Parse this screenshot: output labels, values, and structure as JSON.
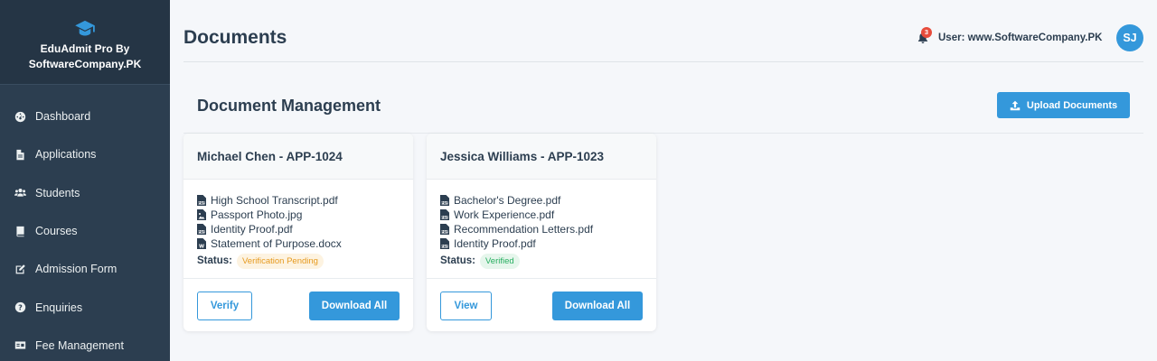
{
  "sidebar": {
    "brand_line1": "EduAdmit Pro By",
    "brand_line2": "SoftwareCompany.PK",
    "brand_icon": "graduation-cap-icon",
    "items": [
      {
        "label": "Dashboard",
        "icon": "dashboard-icon"
      },
      {
        "label": "Applications",
        "icon": "file-icon"
      },
      {
        "label": "Students",
        "icon": "users-icon"
      },
      {
        "label": "Courses",
        "icon": "book-icon"
      },
      {
        "label": "Admission Form",
        "icon": "edit-icon"
      },
      {
        "label": "Enquiries",
        "icon": "question-icon"
      },
      {
        "label": "Fee Management",
        "icon": "id-card-icon"
      }
    ]
  },
  "header": {
    "title": "Documents",
    "notification_count": "3",
    "user_label": "User: www.SoftwareCompany.PK",
    "avatar_initials": "SJ"
  },
  "section": {
    "title": "Document Management",
    "upload_label": "Upload Documents"
  },
  "cards": [
    {
      "title": "Michael Chen - APP-1024",
      "documents": [
        "High School Transcript.pdf",
        "Passport Photo.jpg",
        "Identity Proof.pdf",
        "Statement of Purpose.docx"
      ],
      "status_label": "Status:",
      "status": "Verification Pending",
      "secondary_action": "Verify",
      "primary_action": "Download All"
    },
    {
      "title": "Jessica Williams - APP-1023",
      "documents": [
        "Bachelor's Degree.pdf",
        "Work Experience.pdf",
        "Recommendation Letters.pdf",
        "Identity Proof.pdf"
      ],
      "status_label": "Status:",
      "status": "Verified",
      "secondary_action": "View",
      "primary_action": "Download All"
    }
  ],
  "colors": {
    "sidebar_bg": "#2c3e50",
    "accent": "#3498db",
    "pending": "#e69a1f",
    "verified": "#27ae60",
    "notification": "#e74c3c"
  }
}
